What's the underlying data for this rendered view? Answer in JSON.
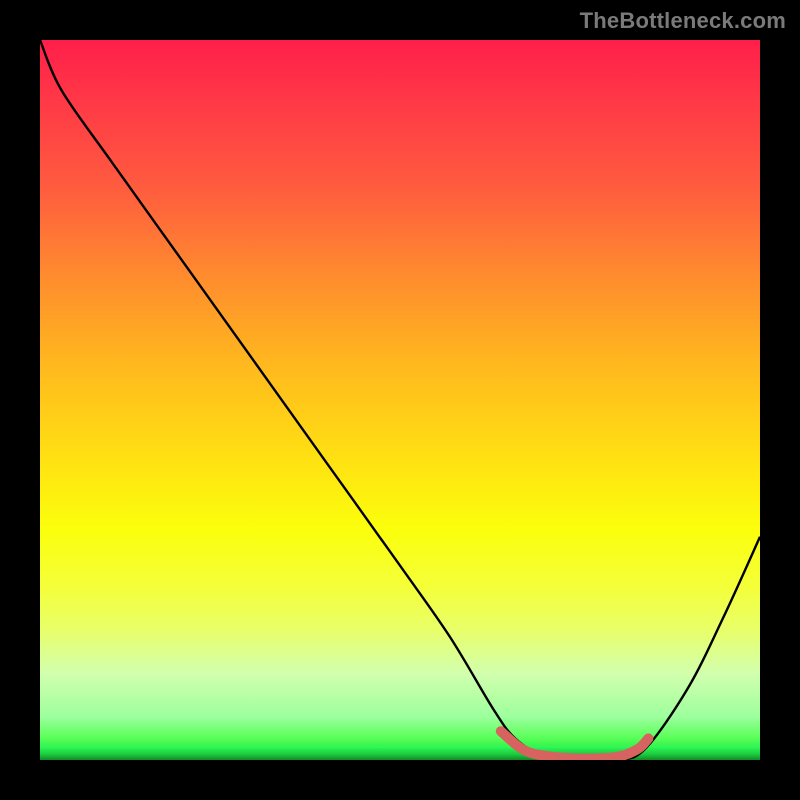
{
  "watermark": "TheBottleneck.com",
  "chart_data": {
    "type": "line",
    "title": "",
    "xlabel": "",
    "ylabel": "",
    "xlim": [
      0,
      100
    ],
    "ylim": [
      0,
      100
    ],
    "grid": false,
    "legend": false,
    "series": [
      {
        "name": "bottleneck-curve",
        "x": [
          0,
          3,
          10,
          20,
          30,
          40,
          50,
          57,
          63,
          66,
          70,
          75,
          80,
          84,
          90,
          95,
          100
        ],
        "y": [
          100,
          93,
          83,
          69,
          55,
          41,
          27,
          17,
          7,
          3,
          0.5,
          0,
          0,
          1.5,
          10,
          20,
          31
        ]
      },
      {
        "name": "optimal-range-highlight",
        "x": [
          64,
          67,
          70,
          75,
          80,
          83,
          84.5
        ],
        "y": [
          4,
          1.5,
          0.6,
          0.2,
          0.4,
          1.5,
          3
        ]
      }
    ],
    "background_gradient": {
      "direction": "vertical",
      "stops": [
        {
          "pos": 0.0,
          "color": "#ff1f4a"
        },
        {
          "pos": 0.2,
          "color": "#ff5a3f"
        },
        {
          "pos": 0.45,
          "color": "#ffb81e"
        },
        {
          "pos": 0.68,
          "color": "#fbff0c"
        },
        {
          "pos": 0.88,
          "color": "#d2ffae"
        },
        {
          "pos": 0.99,
          "color": "#1fe84a"
        },
        {
          "pos": 1.0,
          "color": "#188f2e"
        }
      ]
    },
    "highlight_color": "#d6635f"
  }
}
